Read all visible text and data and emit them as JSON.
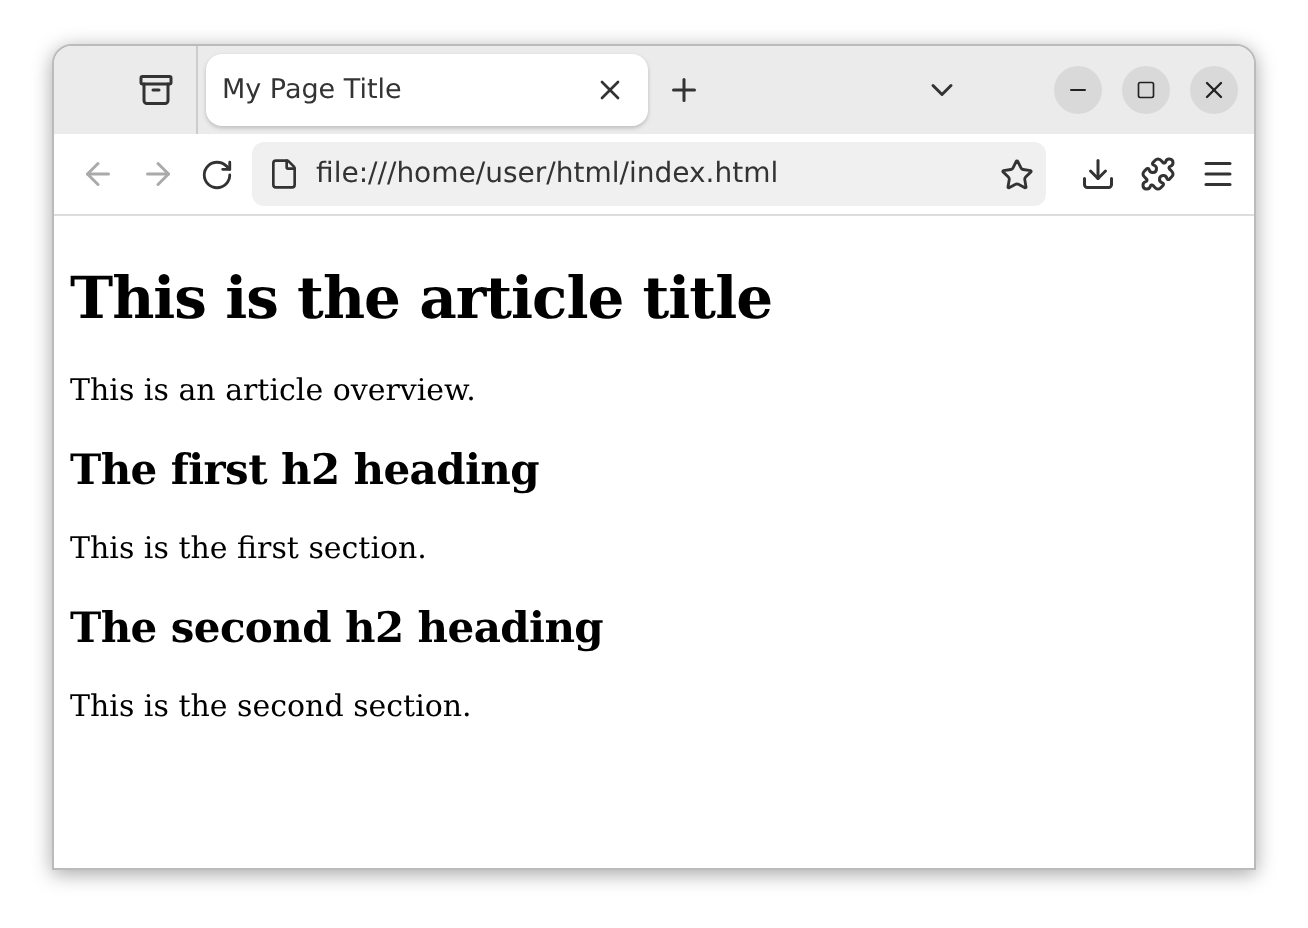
{
  "tabs": [
    {
      "title": "My Page Title",
      "selected": true
    }
  ],
  "toolbar": {
    "back_disabled": true,
    "forward_disabled": true,
    "address": "file:///home/user/html/index.html"
  },
  "content": [
    {
      "kind": "h1",
      "text": "This is the article title"
    },
    {
      "kind": "p",
      "text": "This is an article overview."
    },
    {
      "kind": "h2",
      "text": "The first h2 heading"
    },
    {
      "kind": "p",
      "text": "This is the first section."
    },
    {
      "kind": "h2",
      "text": "The second h2 heading"
    },
    {
      "kind": "p",
      "text": "This is the second section."
    }
  ]
}
